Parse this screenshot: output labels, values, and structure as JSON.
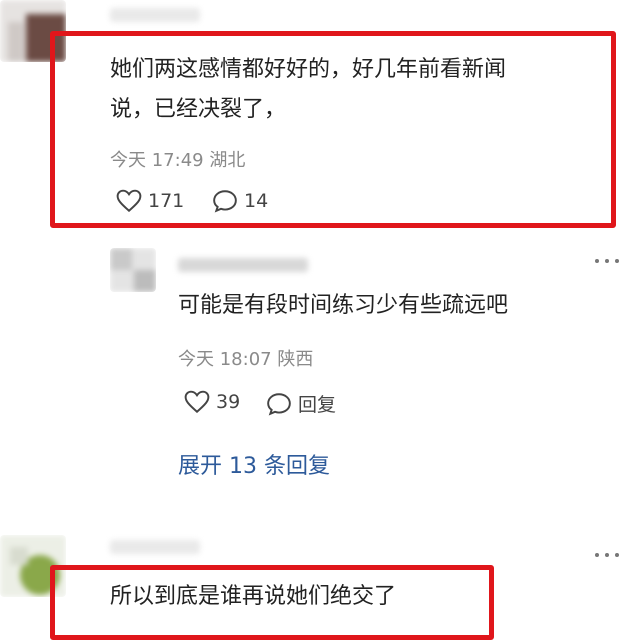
{
  "comments": [
    {
      "text_line1": "她们两这感情都好好的，好几年前看新闻",
      "text_line2": "说，已经决裂了，",
      "time": "今天 17:49",
      "location": "湖北",
      "likes": "171",
      "replies": "14"
    },
    {
      "text": "可能是有段时间练习少有些疏远吧",
      "time": "今天 18:07",
      "location": "陕西",
      "likes": "39",
      "reply_label": "回复",
      "expand_label": "展开 13 条回复"
    },
    {
      "text": "所以到底是谁再说她们绝交了"
    }
  ],
  "icons": [
    "heart-icon",
    "comment-icon",
    "more-icon"
  ],
  "colors": {
    "highlight": "#e0161b",
    "link": "#2d5a9a",
    "meta": "#8a8a8a"
  }
}
